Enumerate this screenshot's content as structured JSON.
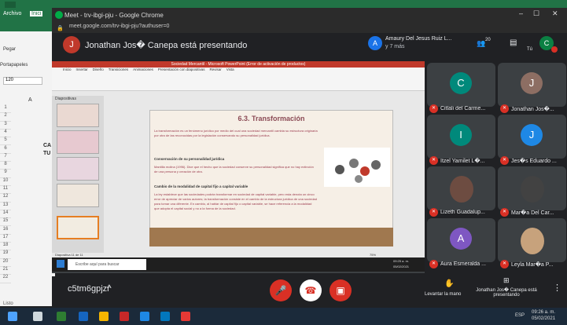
{
  "excel": {
    "tab_file": "Archivo",
    "tab_home": "Inici",
    "paste": "Pegar",
    "clipboard": "Portapapeles",
    "font_size": "120",
    "col_a": "A",
    "rows": [
      "1",
      "2",
      "3",
      "4",
      "5",
      "6",
      "7",
      "8",
      "9",
      "10",
      "11",
      "12",
      "13",
      "14",
      "15",
      "16",
      "17",
      "18",
      "19",
      "20",
      "21",
      "22"
    ],
    "cells": [
      "CA",
      "TU"
    ],
    "status": "Listo"
  },
  "chrome": {
    "title": "Meet - trv-ibgi-pju - Google Chrome",
    "url": "meet.google.com/trv-ibgi-pju?authuser=0"
  },
  "meet": {
    "presenter_initial": "J",
    "presenter_text": "Jonathan Jos� Canepa está presentando",
    "top_user_initial": "A",
    "top_user_name": "Amaury Del Jesus Ruiz L...",
    "top_user_more": "y 7 más",
    "participants_count": "20",
    "self_initial": "C",
    "self_label": "Tú",
    "meeting_code": "c5tm6gpjzr",
    "raise_hand": "Levantar la mano",
    "presenting_label": "Jonathan Jos� Canepa está presentando",
    "tiles": [
      {
        "name": "Citlali del Carme...",
        "initial": "C",
        "color": "#00897b"
      },
      {
        "name": "Jonathan Jos�...",
        "initial": "J",
        "color": "#8d6e63"
      },
      {
        "name": "Itzel Yamilet L�...",
        "initial": "I",
        "color": "#00897b"
      },
      {
        "name": "Jes�s Eduardo ...",
        "initial": "J",
        "color": "#1e88e5"
      },
      {
        "name": "Lizeth Guadalup...",
        "initial": "",
        "color": "#6d4c41"
      },
      {
        "name": "Mar�a Del Car...",
        "initial": "",
        "color": "#424242"
      },
      {
        "name": "Aura Esmeralda ...",
        "initial": "A",
        "color": "#7e57c2"
      },
      {
        "name": "Leyla Mar�a P...",
        "initial": "",
        "color": "#c7a27c"
      }
    ]
  },
  "ppt": {
    "window_title": "Sociedad Mercantil - Microsoft PowerPoint (Error de activación de productos)",
    "tabs": [
      "Inicio",
      "Insertar",
      "Diseño",
      "Transiciones",
      "Animaciones",
      "Presentación con diapositivas",
      "Revisar",
      "Vista"
    ],
    "slide_tab": "Diapositivas",
    "slide_status": "Diapositiva 11 de 11",
    "zoom": "75%"
  },
  "slide": {
    "title": "6.3. Transformación",
    "intro": "La transformación es un fenómeno jurídico por medio del cual una sociedad mercantil cambia su estructura originaria por otra de las reconocidas por la legislación conservando su personalidad jurídica.",
    "h1": "Conservación de su personalidad jurídica",
    "p1": "Mantilla molina (1996). Dice que el hecho que la sociedad conserve su personalidad significa que no hay extinción de una persona y creación de otra.",
    "h2": "Cambio de la modalidad de capital fijo a capital variable",
    "p2": "La ley establece que las sociedades podrán transformar en sociedad de capital variable, pero esta denota un cinco error de apreciar de varios autores; la transformación consiste en el cambio de la estructura jurídica de una sociedad para tomar una diferente. En cambio, al hablar de capital fijo o capital variable, se hace referencia a la modalidad que adopta el capital social y no a la forma de la sociedad."
  },
  "inner_taskbar": {
    "search": "Escribe aquí para buscar",
    "time": "09:25 a. m.",
    "date": "05/02/2021"
  },
  "taskbar": {
    "lang": "ESP",
    "time": "09:26 a. m.",
    "date": "05/02/2021"
  }
}
